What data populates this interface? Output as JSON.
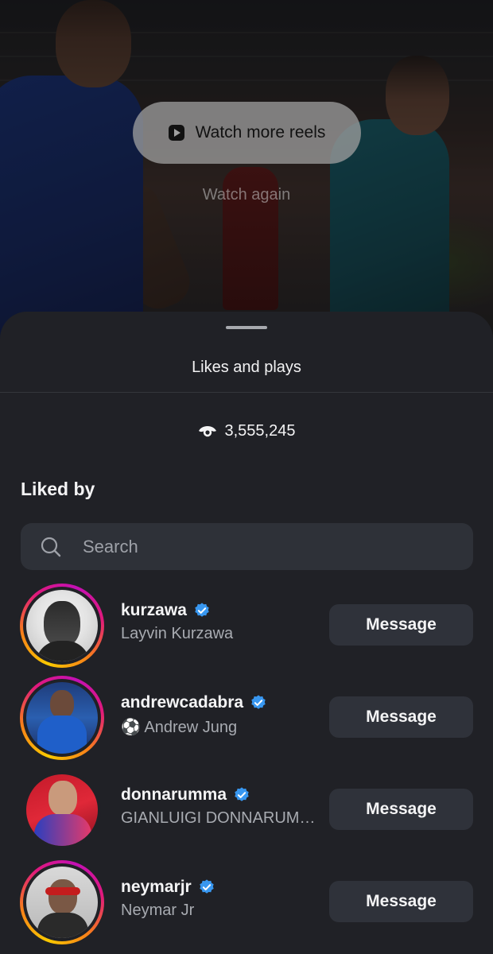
{
  "video": {
    "watch_more_label": "Watch more reels",
    "watch_again_label": "Watch again"
  },
  "sheet": {
    "title": "Likes and plays",
    "plays_count": "3,555,245",
    "liked_by_label": "Liked by",
    "search": {
      "placeholder": "Search",
      "value": ""
    }
  },
  "users": [
    {
      "username": "kurzawa",
      "full_name": "Layvin Kurzawa",
      "verified": true,
      "story_ring": true,
      "button_label": "Message"
    },
    {
      "username": "andrewcadabra",
      "full_name": "⚽ Andrew Jung",
      "verified": true,
      "story_ring": true,
      "button_label": "Message"
    },
    {
      "username": "donnarumma",
      "full_name": "GIANLUIGI DONNARUMMA",
      "verified": true,
      "story_ring": false,
      "button_label": "Message"
    },
    {
      "username": "neymarjr",
      "full_name": "Neymar Jr",
      "verified": true,
      "story_ring": true,
      "button_label": "Message"
    }
  ],
  "colors": {
    "sheet_bg": "#202126",
    "verified_blue": "#3897f0",
    "button_bg": "#2f323a",
    "secondary_text": "#a8abb1"
  }
}
